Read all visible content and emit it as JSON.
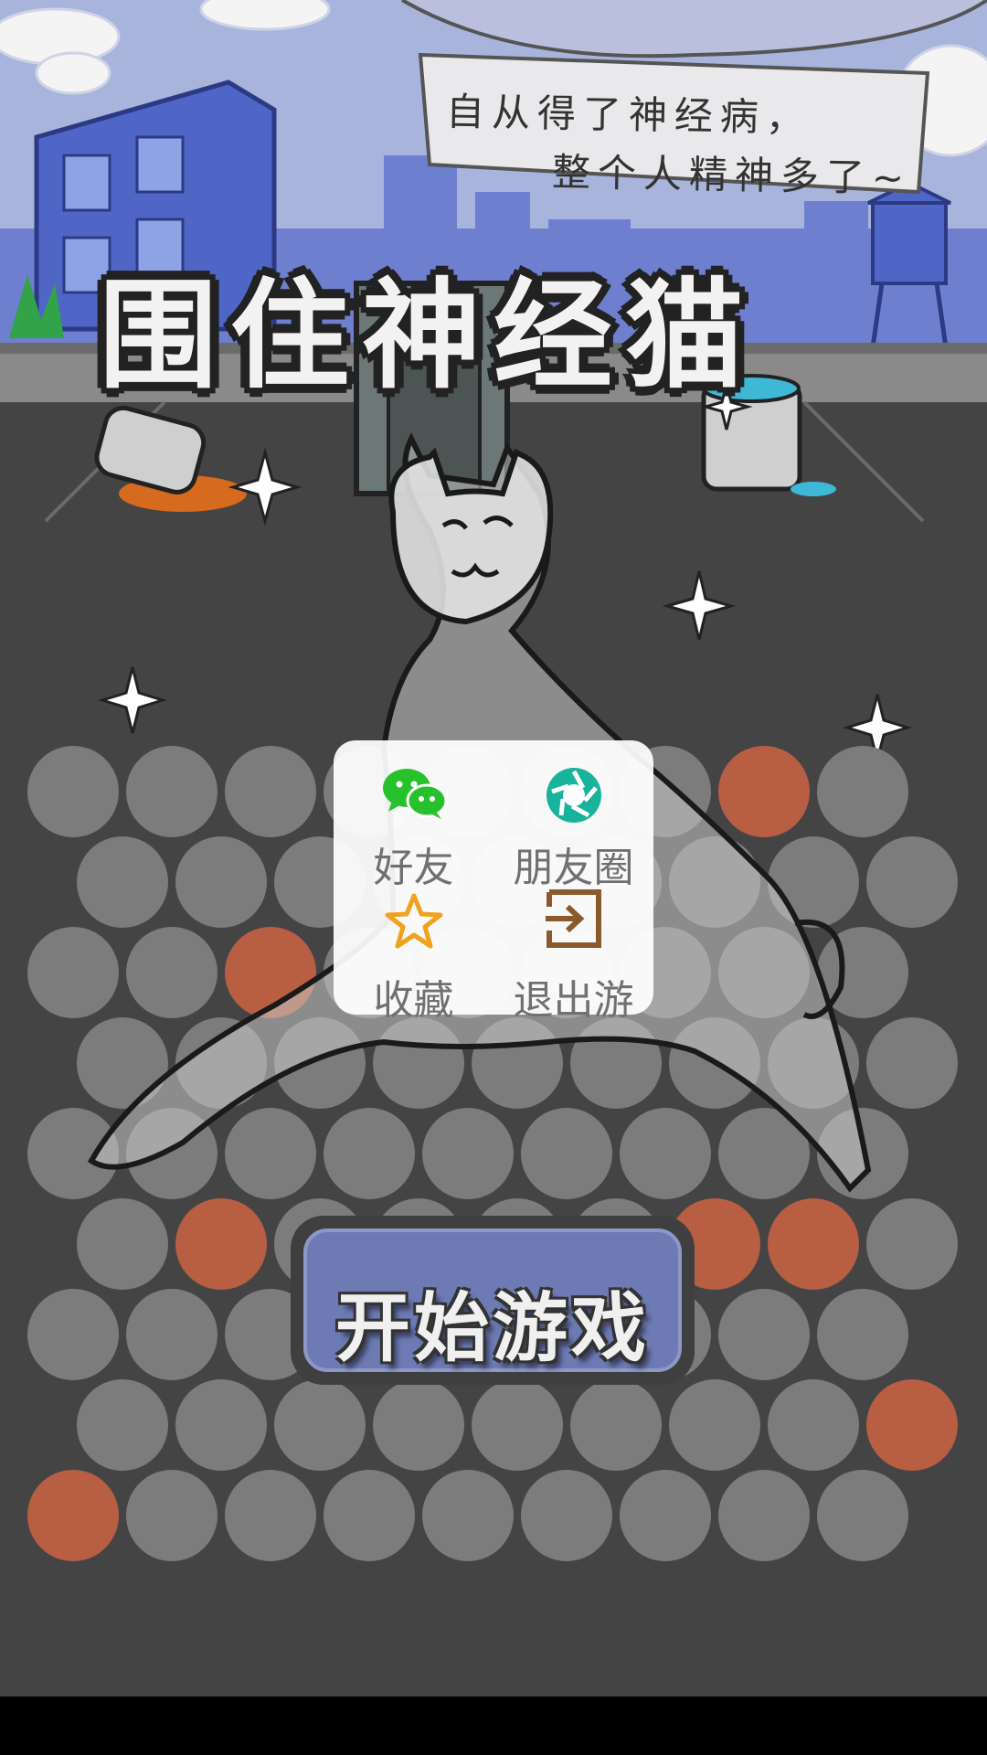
{
  "app": {
    "banner_line_1": "自从得了神经病，",
    "banner_line_2": "整个人精神多了~",
    "title": "围住神经猫",
    "start_button_label": "开始游戏"
  },
  "menu": {
    "items": [
      {
        "label": "好友",
        "icon": "wechat-icon"
      },
      {
        "label": "朋友圈",
        "icon": "moments-icon"
      },
      {
        "label": "收藏",
        "icon": "star-icon"
      },
      {
        "label": "退出游",
        "icon": "exit-icon"
      }
    ]
  },
  "board": {
    "rows": 9,
    "cols": 9,
    "blocked": [
      [
        0,
        7
      ],
      [
        2,
        2
      ],
      [
        5,
        1
      ],
      [
        5,
        6
      ],
      [
        5,
        7
      ],
      [
        7,
        8
      ],
      [
        8,
        0
      ]
    ],
    "colors": {
      "empty": "#7c7c7c",
      "blocked": "#b75e43",
      "background": "#444444",
      "menu_icon_green": "#27c22b",
      "moments_teal": "#17b39a",
      "star_orange": "#f0a21d",
      "exit_brown": "#8a5a2c"
    }
  }
}
